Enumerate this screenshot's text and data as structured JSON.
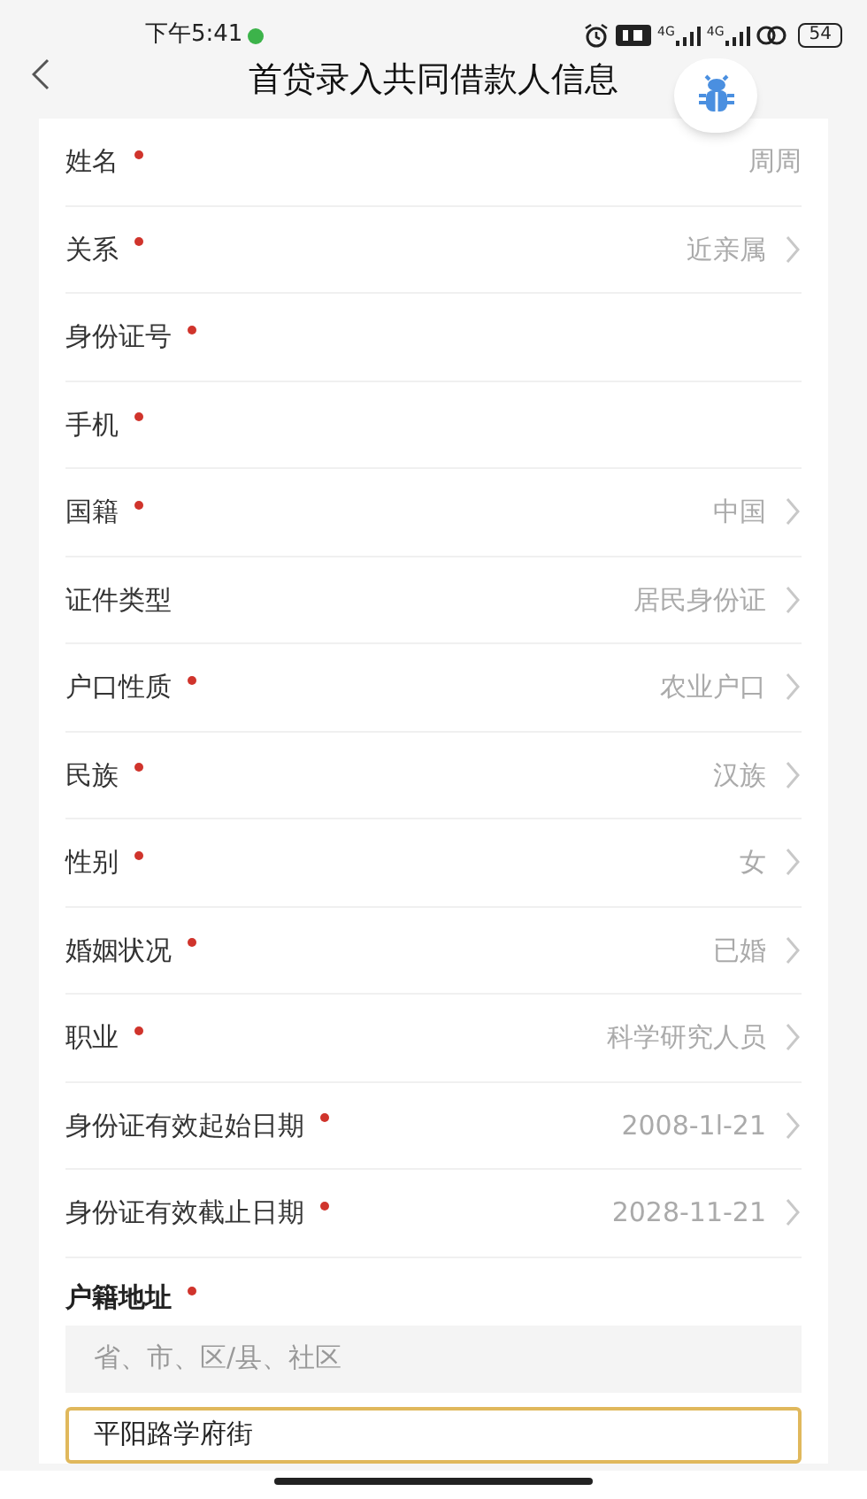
{
  "status_bar": {
    "time": "下午5:41",
    "network_labels": [
      "4G",
      "4G"
    ],
    "battery": "54"
  },
  "header": {
    "title": "首贷录入共同借款人信息"
  },
  "fields": [
    {
      "label": "姓名",
      "required": true,
      "value": "周周",
      "kind": "text"
    },
    {
      "label": "关系",
      "required": true,
      "value": "近亲属",
      "kind": "select"
    },
    {
      "label": "身份证号",
      "required": true,
      "kind": "text"
    },
    {
      "label": "手机",
      "required": true,
      "kind": "text"
    },
    {
      "label": "国籍",
      "required": true,
      "value": "中国",
      "kind": "select"
    },
    {
      "label": "证件类型",
      "required": false,
      "value": "居民身份证",
      "kind": "select"
    },
    {
      "label": "户口性质",
      "required": true,
      "value": "农业户口",
      "kind": "select"
    },
    {
      "label": "民族",
      "required": true,
      "value": "汉族",
      "kind": "select"
    },
    {
      "label": "性别",
      "required": true,
      "value": "女",
      "kind": "select"
    },
    {
      "label": "婚姻状况",
      "required": true,
      "value": "已婚",
      "kind": "select"
    },
    {
      "label": "职业",
      "required": true,
      "value": "科学研究人员",
      "kind": "select"
    },
    {
      "label": "身份证有效起始日期",
      "required": true,
      "value": "2008-1l-21",
      "kind": "select"
    },
    {
      "label": "身份证有效截止日期",
      "required": true,
      "value": "2028-11-21",
      "kind": "select"
    }
  ],
  "address": {
    "label": "户籍地址",
    "required": true,
    "region_placeholder": "省、市、区/县、社区",
    "detail_value": "平阳路学府街"
  }
}
